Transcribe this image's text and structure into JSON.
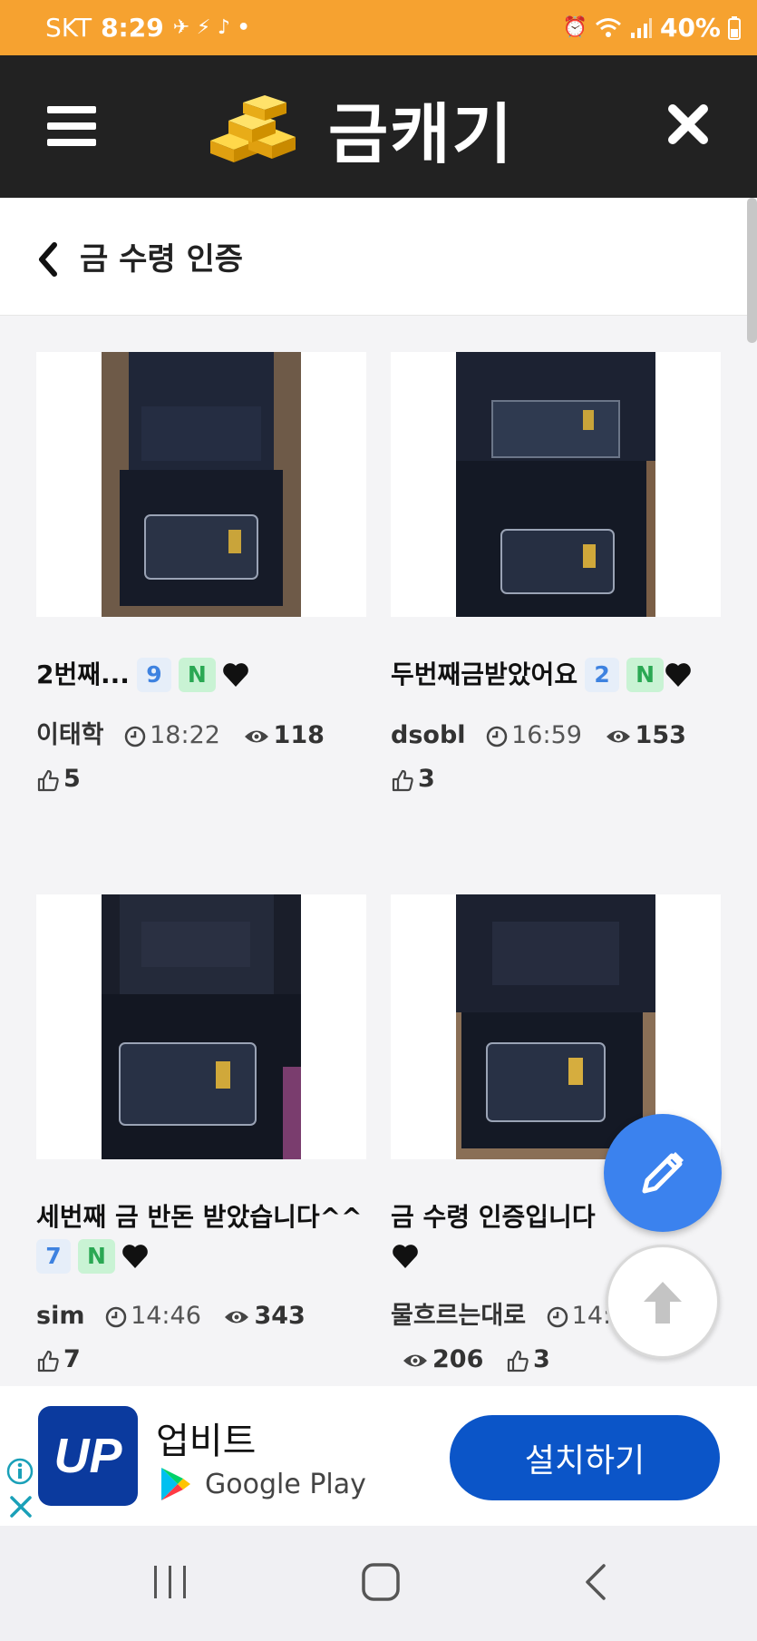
{
  "status_bar": {
    "carrier": "SKT",
    "time": "8:29",
    "battery": "40%"
  },
  "app": {
    "title": "금캐기"
  },
  "page": {
    "title": "금 수령 인증"
  },
  "posts": [
    {
      "title": "2번째...",
      "comments": "9",
      "new_badge": "N",
      "author": "이태학",
      "time": "18:22",
      "views": "118",
      "likes": "5"
    },
    {
      "title": "두번째금받았어요",
      "comments": "2",
      "new_badge": "N",
      "author": "dsobl",
      "time": "16:59",
      "views": "153",
      "likes": "3"
    },
    {
      "title": "세번째 금 반돈 받았습니다^^",
      "comments": "7",
      "new_badge": "N",
      "author": "sim",
      "time": "14:46",
      "views": "343",
      "likes": "7"
    },
    {
      "title": "금 수령 인증입니다",
      "author": "물흐르는대로",
      "time": "14:",
      "views": "206",
      "likes": "3"
    }
  ],
  "ad": {
    "app_name": "업비트",
    "store": "Google Play",
    "install_label": "설치하기",
    "logo_text": "UP"
  },
  "colors": {
    "status_bar": "#f6a230",
    "header": "#222222",
    "fab": "#3b82ee",
    "install_button": "#0b55c8",
    "count_badge_text": "#3e82e0",
    "new_badge_bg": "#c9f3d4"
  }
}
